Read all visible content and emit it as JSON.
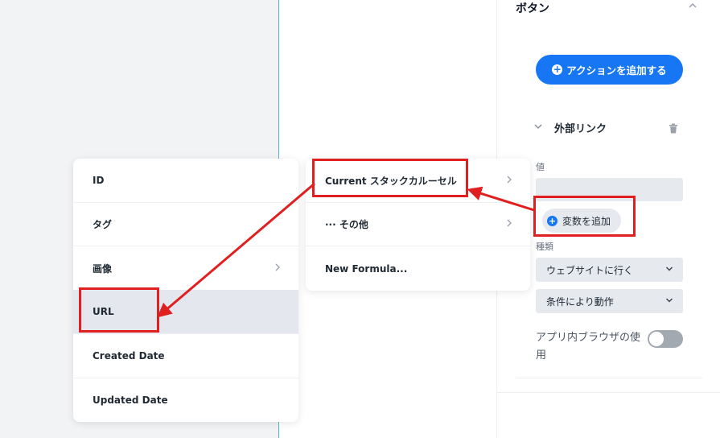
{
  "panel": {
    "title": "ボタン",
    "action_button_label": "アクションを追加する",
    "section_title": "外部リンク",
    "value_label": "値",
    "add_variable_label": "変数を追加",
    "type_label": "種類",
    "type_select": "ウェブサイトに行く",
    "condition_select": "条件により動作",
    "in_app_browser_label": "アプリ内ブラウザの使用"
  },
  "menu_left": {
    "items": [
      {
        "label": "ID"
      },
      {
        "label": "タグ"
      },
      {
        "label": "画像",
        "has_submenu": true
      },
      {
        "label": "URL",
        "active": true
      },
      {
        "label": "Created Date"
      },
      {
        "label": "Updated Date"
      }
    ]
  },
  "menu_right": {
    "items": [
      {
        "label": "Current スタックカルーセル",
        "has_submenu": true
      },
      {
        "label": "··· その他",
        "has_submenu": true
      },
      {
        "label": "New Formula..."
      }
    ]
  },
  "colors": {
    "accent": "#1676f3",
    "annotation_red": "#e02020",
    "canvas_bg": "#f2f3f5",
    "field_bg": "#e6e9ee"
  },
  "icons": {
    "collapse": "chevron-up-icon",
    "section": "chevron-down-icon",
    "delete": "trash-icon",
    "add": "plus-circle-icon",
    "submenu": "chevron-right-icon"
  }
}
